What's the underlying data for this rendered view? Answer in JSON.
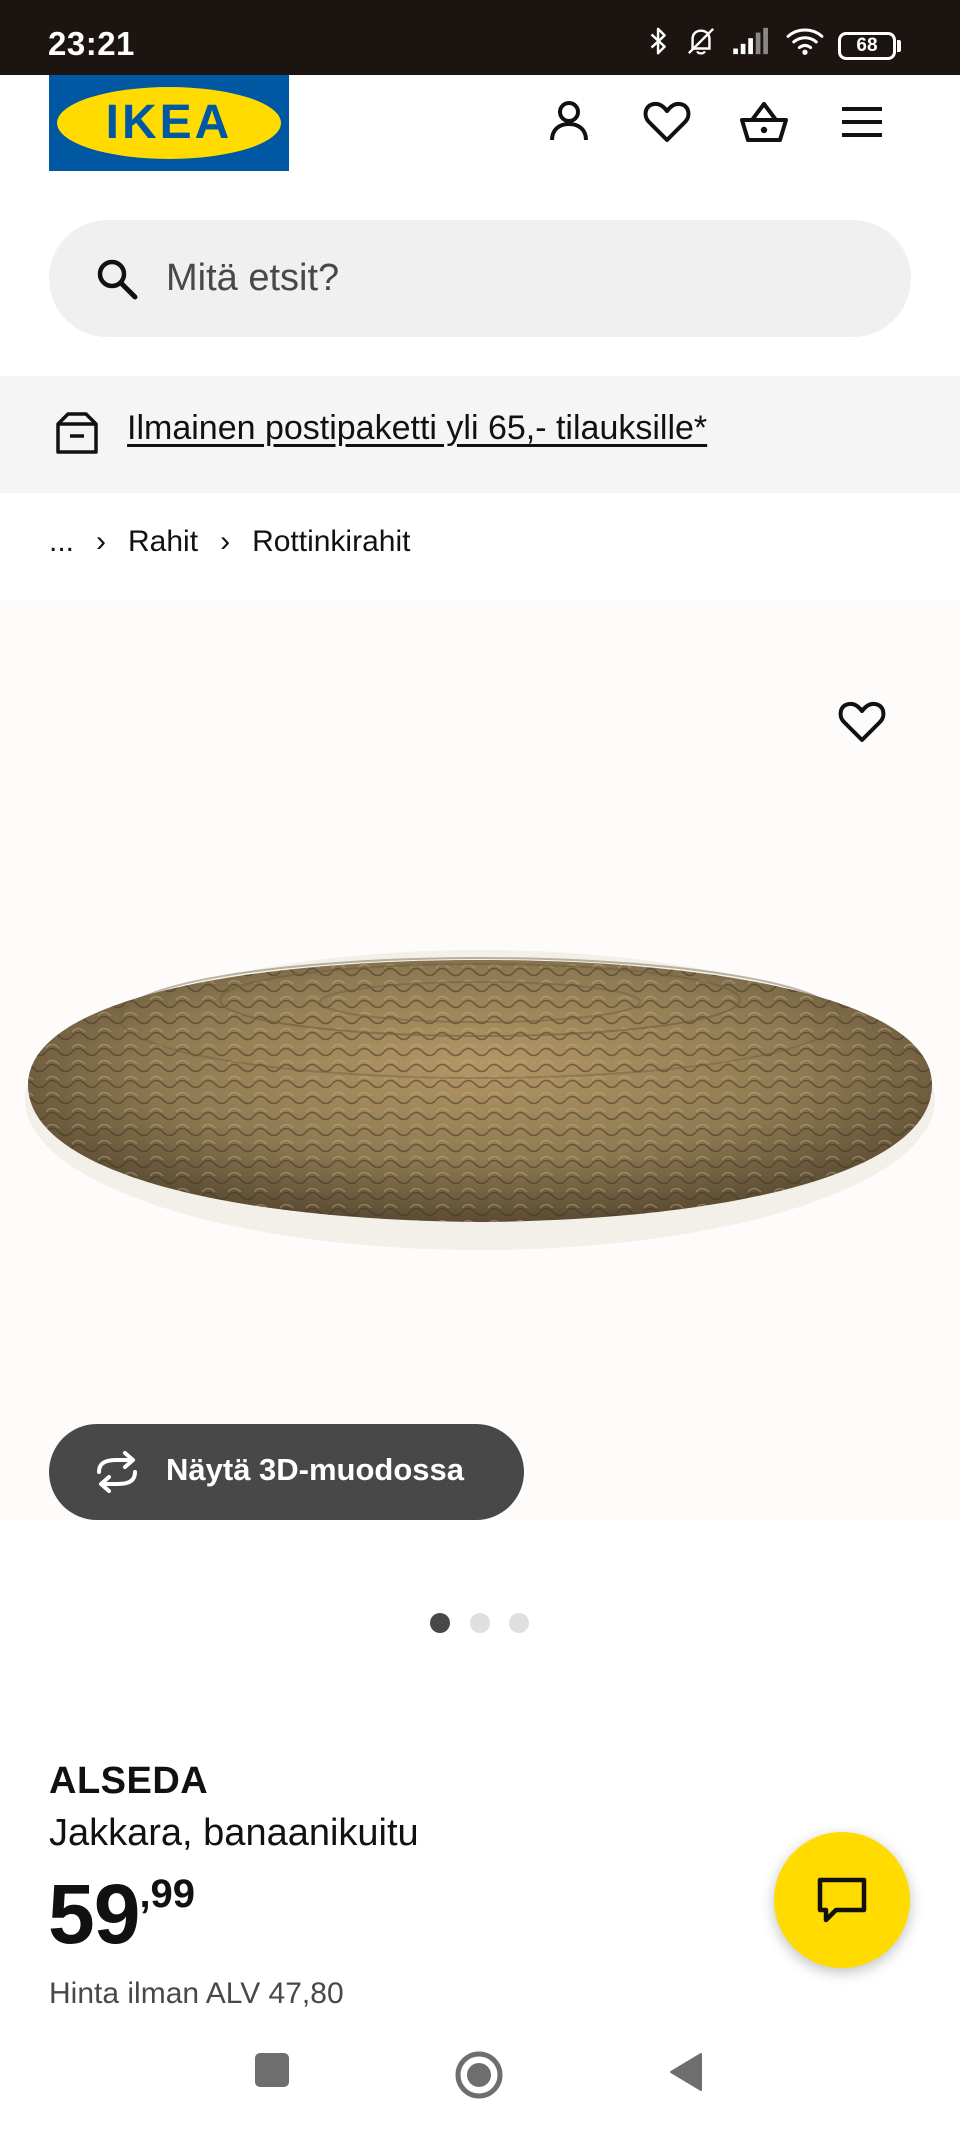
{
  "status_bar": {
    "time": "23:21",
    "battery": "68",
    "icons": [
      "bluetooth-icon",
      "bell-muted-icon",
      "signal-icon",
      "wifi-icon",
      "battery-icon"
    ]
  },
  "header": {
    "logo_text": "IKEA",
    "icons": [
      "account-icon",
      "wishlist-heart-icon",
      "shopping-basket-icon",
      "menu-icon"
    ]
  },
  "search": {
    "placeholder": "Mitä etsit?"
  },
  "banner": {
    "text": "Ilmainen postipaketti yli 65,- tilauksille*"
  },
  "breadcrumb": {
    "items": [
      "...",
      "Rahit",
      "Rottinkirahit"
    ]
  },
  "gallery": {
    "view_3d_label": "Näytä 3D-muodossa",
    "slides": 3,
    "active_slide": 1
  },
  "product": {
    "name": "ALSEDA",
    "description": "Jakkara, banaanikuitu",
    "price_int": "59",
    "price_dec": ",99",
    "price_ex_vat": "Hinta ilman ALV 47,80"
  },
  "colors": {
    "ikea_blue": "#0058a3",
    "ikea_yellow": "#ffdb00",
    "button_dark": "#484848"
  }
}
